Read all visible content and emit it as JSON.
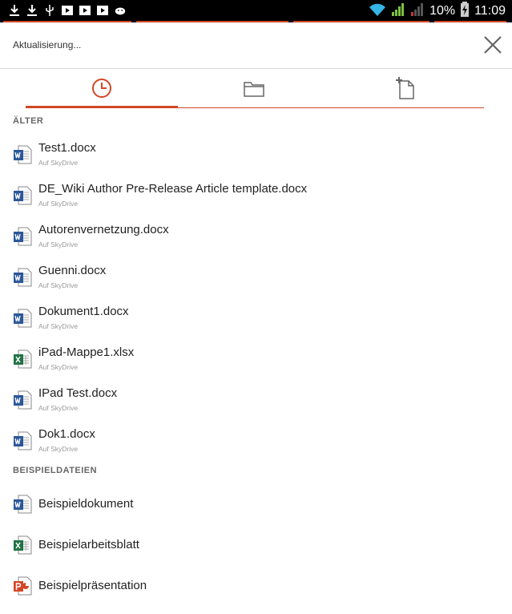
{
  "statusbar": {
    "battery": "10%",
    "time": "11:09",
    "notification_icons": [
      "download-icon",
      "download-icon",
      "usb-icon",
      "media-icon",
      "media-icon",
      "media-icon",
      "android-debug-icon"
    ]
  },
  "header": {
    "title": "Aktualisierung..."
  },
  "tabs": [
    {
      "id": "recent",
      "icon": "clock-icon",
      "active": true
    },
    {
      "id": "open",
      "icon": "folder-icon",
      "active": false
    },
    {
      "id": "new",
      "icon": "new-document-icon",
      "active": false
    }
  ],
  "sections": {
    "older": {
      "label": "ÄLTER",
      "items": [
        {
          "name": "Test1.docx",
          "location": "Auf SkyDrive",
          "type": "word"
        },
        {
          "name": "DE_Wiki Author Pre-Release Article template.docx",
          "location": "Auf SkyDrive",
          "type": "word"
        },
        {
          "name": "Autorenvernetzung.docx",
          "location": "Auf SkyDrive",
          "type": "word"
        },
        {
          "name": "Guenni.docx",
          "location": "Auf SkyDrive",
          "type": "word"
        },
        {
          "name": "Dokument1.docx",
          "location": "Auf SkyDrive",
          "type": "word"
        },
        {
          "name": "iPad-Mappe1.xlsx",
          "location": "Auf SkyDrive",
          "type": "excel"
        },
        {
          "name": "IPad Test.docx",
          "location": "Auf SkyDrive",
          "type": "word"
        },
        {
          "name": "Dok1.docx",
          "location": "Auf SkyDrive",
          "type": "word"
        }
      ]
    },
    "samples": {
      "label": "BEISPIELDATEIEN",
      "items": [
        {
          "name": "Beispieldokument",
          "type": "word"
        },
        {
          "name": "Beispielarbeitsblatt",
          "type": "excel"
        },
        {
          "name": "Beispielpräsentation",
          "type": "powerpoint"
        }
      ]
    }
  },
  "colors": {
    "accent": "#d24726",
    "word": "#2b579a",
    "excel": "#217346",
    "powerpoint": "#d24726"
  }
}
